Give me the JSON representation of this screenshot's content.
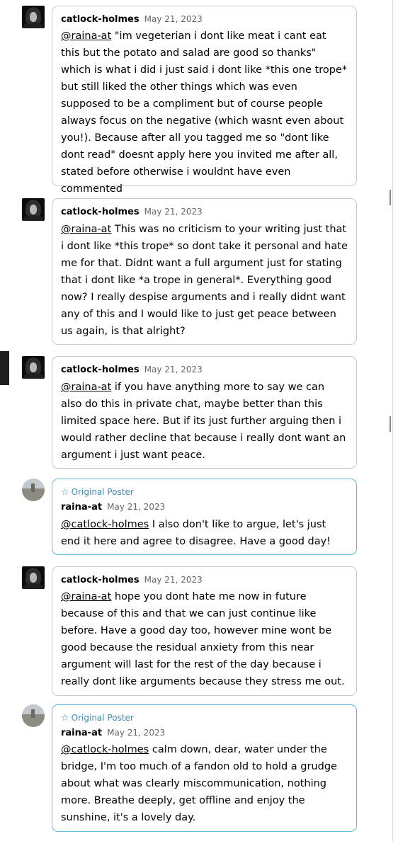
{
  "thread": {
    "op_badge_label": "Original Poster",
    "comments": [
      {
        "username": "catlock-holmes",
        "date": "May 21, 2023",
        "mention": "@raina-at",
        "text": " \"im vegeterian i dont like meat i cant eat this but the potato and salad are good so thanks\" which is what i did i just said i dont like *this one trope* but still liked the other things which was even supposed to be a compliment but of course people always focus on the negative (which wasnt even about you!). Because after all you tagged me so \"dont like dont read\" doesnt apply here you invited me after all, stated before otherwise i wouldnt have even commented",
        "is_op": false
      },
      {
        "username": "catlock-holmes",
        "date": "May 21, 2023",
        "mention": "@raina-at",
        "text": " This was no criticism to your writing just that i dont like *this trope* so dont take it personal and hate me for that. Didnt want a full argument just for stating that i dont like *a trope in general*. Everything good now? I really despise arguments and i really didnt want any of this and I would like to just get peace between us again, is that alright?",
        "is_op": false
      },
      {
        "username": "catlock-holmes",
        "date": "May 21, 2023",
        "mention": "@raina-at",
        "text": " if you have anything more to say we can also do this in private chat, maybe better than this limited space here. But if its just further arguing  then i would rather decline that because i really dont want an argument i just want peace.",
        "is_op": false
      },
      {
        "username": "raina-at",
        "date": "May 21, 2023",
        "mention": "@catlock-holmes",
        "text": " I also don't like to argue, let's just end it here and agree to disagree. Have a good day!",
        "is_op": true
      },
      {
        "username": "catlock-holmes",
        "date": "May 21, 2023",
        "mention": "@raina-at",
        "text": " hope you dont hate me now in future because of this and that we can just continue like before. Have a good day too, however mine wont be good because the residual anxiety from this near argument will last for the rest of the day because i really dont like arguments because they stress me out.",
        "is_op": false
      },
      {
        "username": "raina-at",
        "date": "May 21, 2023",
        "mention": "@catlock-holmes",
        "text": " calm down, dear, water under the bridge, I'm too much of a fandon old to hold a grudge about what was clearly miscommunication, nothing more. Breathe deeply, get offline and enjoy the sunshine, it's a lovely day.",
        "is_op": true
      }
    ]
  },
  "icons": {
    "op_star": "☆"
  },
  "colors": {
    "op_accent": "#3d8fb5",
    "op_border": "#5fbcd6",
    "bubble_border": "#c8c8c8"
  }
}
